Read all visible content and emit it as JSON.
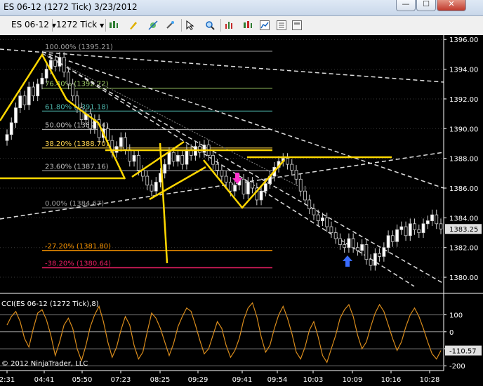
{
  "window": {
    "title": "ES 06-12 (1272 Tick)  3/23/2012",
    "buttons": {
      "minimize": "—",
      "maximize": "☐",
      "close": "✕"
    }
  },
  "toolbar": {
    "instrument": "ES 06-12",
    "interval": "1272 Tick",
    "icons": [
      "bar-type-icon",
      "draw-pencil-icon",
      "draw-tool-icon",
      "link-icon",
      "pointer-icon",
      "zoom-icon",
      "indicators-icon",
      "strategies-icon",
      "chart-data-icon",
      "properties-icon"
    ]
  },
  "chart_data": {
    "type": "candlestick",
    "price_axis": {
      "min": 1379.2,
      "max": 1396.2,
      "ticks": [
        "1396.00",
        "1394.00",
        "1392.00",
        "1390.00",
        "1388.00",
        "1386.00",
        "1384.00",
        "1382.00",
        "1380.00"
      ],
      "current_price": "1383.25"
    },
    "time_axis": {
      "ticks": [
        "2:31",
        "04:41",
        "05:50",
        "07:23",
        "08:25",
        "09:29",
        "09:41",
        "09:54",
        "10:03",
        "10:09",
        "10:16",
        "10:28"
      ]
    },
    "fibonacci": [
      {
        "label": "100.00% (1395.21)",
        "price": 1395.21,
        "color": "#9e9e9e"
      },
      {
        "label": "76.40% (1392.72)",
        "price": 1392.72,
        "color": "#9ccc65"
      },
      {
        "label": "61.80% (1391.18)",
        "price": 1391.18,
        "color": "#4db6ac"
      },
      {
        "label": "50.00% (1389.94)",
        "price": 1389.94,
        "color": "#bdbdbd"
      },
      {
        "label": "38.20% (1388.70)",
        "price": 1388.7,
        "color": "#ffd54f"
      },
      {
        "label": "23.60% (1387.16)",
        "price": 1387.16,
        "color": "#bdbdbd"
      },
      {
        "label": "0.00% (1384.67)",
        "price": 1384.67,
        "color": "#9e9e9e"
      },
      {
        "label": "-27.20% (1381.80)",
        "price": 1381.8,
        "color": "#ff9800"
      },
      {
        "label": "-38.20% (1380.64)",
        "price": 1380.64,
        "color": "#e91e63"
      }
    ],
    "closes": [
      1389.6,
      1390.4,
      1391.4,
      1392.2,
      1391.6,
      1392.8,
      1392.2,
      1393.0,
      1393.4,
      1394.0,
      1394.6,
      1394.2,
      1394.8,
      1393.8,
      1393.0,
      1392.2,
      1391.4,
      1390.6,
      1391.0,
      1390.0,
      1390.6,
      1389.4,
      1390.0,
      1389.2,
      1388.4,
      1388.8,
      1389.4,
      1388.6,
      1387.8,
      1388.2,
      1387.2,
      1386.8,
      1386.2,
      1385.8,
      1386.4,
      1387.0,
      1387.6,
      1388.4,
      1387.8,
      1388.2,
      1387.6,
      1388.6,
      1388.2,
      1388.8,
      1388.4,
      1388.9,
      1388.2,
      1387.6,
      1387.2,
      1386.8,
      1386.4,
      1385.8,
      1386.2,
      1386.6,
      1385.6,
      1386.4,
      1386.0,
      1385.2,
      1385.8,
      1386.3,
      1386.8,
      1387.4,
      1387.8,
      1388.0,
      1387.6,
      1387.2,
      1386.6,
      1385.8,
      1385.2,
      1384.6,
      1384.2,
      1383.8,
      1384.0,
      1383.4,
      1383.0,
      1382.6,
      1382.2,
      1382.0,
      1382.6,
      1382.0,
      1381.8,
      1382.2,
      1381.2,
      1380.8,
      1381.6,
      1381.4,
      1382.0,
      1382.8,
      1382.4,
      1383.2,
      1383.4,
      1382.8,
      1383.6,
      1383.2,
      1383.0,
      1383.6,
      1383.8,
      1384.2,
      1383.6,
      1383.25
    ],
    "indicator": {
      "name": "CCI(ES 06-12 (1272 Tick),8)",
      "ticks": [
        "100",
        "0",
        "-100",
        "-200"
      ],
      "current": "-110.57",
      "min": -220,
      "max": 185,
      "values": [
        40,
        90,
        120,
        60,
        -40,
        -90,
        20,
        110,
        130,
        70,
        -20,
        -140,
        -60,
        40,
        80,
        20,
        -100,
        -170,
        -80,
        30,
        100,
        150,
        60,
        -60,
        -150,
        -90,
        10,
        90,
        40,
        -80,
        -160,
        -120,
        0,
        110,
        80,
        20,
        -60,
        -140,
        -70,
        30,
        90,
        140,
        120,
        40,
        -50,
        -130,
        -100,
        -20,
        60,
        20,
        -80,
        -150,
        -110,
        -40,
        70,
        140,
        170,
        90,
        -30,
        -120,
        -80,
        20,
        100,
        150,
        80,
        -10,
        -120,
        -160,
        -90,
        10,
        60,
        -30,
        -140,
        -180,
        -100,
        -20,
        80,
        130,
        160,
        90,
        -20,
        -100,
        -60,
        30,
        110,
        160,
        120,
        40,
        -40,
        -110,
        -60,
        30,
        100,
        140,
        90,
        20,
        -60,
        -130,
        -160,
        -110.57
      ]
    },
    "annotations": {
      "copyright": "© 2012 NinjaTrader, LLC"
    }
  },
  "colors": {
    "background": "#000000",
    "candle_up": "#ffffff",
    "candle_down": "#000000",
    "drawing": "#ffd700",
    "cci_line": "#d98c1c",
    "grid": "#4a4a4a"
  }
}
